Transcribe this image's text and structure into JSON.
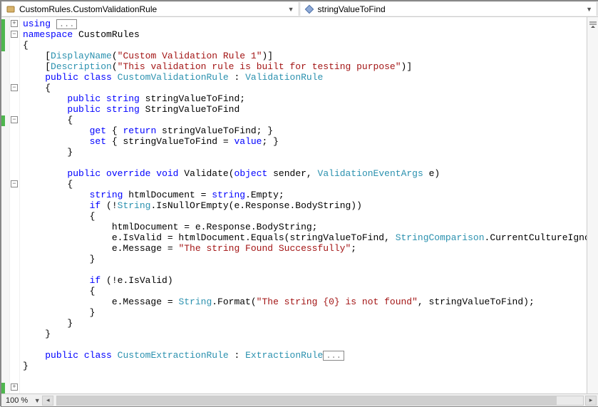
{
  "topbar": {
    "left_label": "CustomRules.CustomValidationRule",
    "right_label": "stringValueToFind"
  },
  "outline": {
    "plus_glyph": "+",
    "minus_glyph": "−",
    "collapsed_placeholder": "..."
  },
  "code": {
    "l01_kw": "using",
    "l02_kw": "namespace",
    "l02_name": "CustomRules",
    "l03": "{",
    "l04_a": "    [",
    "l04_type": "DisplayName",
    "l04_b": "(",
    "l04_str": "\"Custom Validation Rule 1\"",
    "l04_c": ")]",
    "l05_a": "    [",
    "l05_type": "Description",
    "l05_b": "(",
    "l05_str": "\"This validation rule is built for testing purpose\"",
    "l05_c": ")]",
    "l06_a": "    ",
    "l06_kw1": "public",
    "l06_kw2": "class",
    "l06_type1": "CustomValidationRule",
    "l06_colon": " : ",
    "l06_type2": "ValidationRule",
    "l07": "    {",
    "l08_a": "        ",
    "l08_kw1": "public",
    "l08_kw2": "string",
    "l08_name": " stringValueToFind;",
    "l09_a": "        ",
    "l09_kw1": "public",
    "l09_kw2": "string",
    "l09_name": " StringValueToFind",
    "l10": "        {",
    "l11_a": "            ",
    "l11_kw1": "get",
    "l11_b": " { ",
    "l11_kw2": "return",
    "l11_c": " stringValueToFind; }",
    "l12_a": "            ",
    "l12_kw1": "set",
    "l12_b": " { stringValueToFind = ",
    "l12_kw2": "value",
    "l12_c": "; }",
    "l13": "        }",
    "l15_a": "        ",
    "l15_kw1": "public",
    "l15_kw2": "override",
    "l15_kw3": "void",
    "l15_name": " Validate(",
    "l15_kw4": "object",
    "l15_arg": " sender, ",
    "l15_type": "ValidationEventArgs",
    "l15_end": " e)",
    "l16": "        {",
    "l17_a": "            ",
    "l17_kw1": "string",
    "l17_b": " htmlDocument = ",
    "l17_kw2": "string",
    "l17_c": ".Empty;",
    "l18_a": "            ",
    "l18_kw1": "if",
    "l18_b": " (!",
    "l18_type": "String",
    "l18_c": ".IsNullOrEmpty(e.Response.BodyString))",
    "l19": "            {",
    "l20": "                htmlDocument = e.Response.BodyString;",
    "l21_a": "                e.IsValid = htmlDocument.Equals(stringValueToFind, ",
    "l21_type": "StringComparison",
    "l21_b": ".CurrentCultureIgnoreCase);",
    "l22_a": "                e.Message = ",
    "l22_str": "\"The string Found Successfully\"",
    "l22_b": ";",
    "l23": "            }",
    "l25_a": "            ",
    "l25_kw": "if",
    "l25_b": " (!e.IsValid)",
    "l26": "            {",
    "l27_a": "                e.Message = ",
    "l27_type": "String",
    "l27_b": ".Format(",
    "l27_str": "\"The string {0} is not found\"",
    "l27_c": ", stringValueToFind);",
    "l28": "            }",
    "l29": "        }",
    "l30": "    }",
    "l32_a": "    ",
    "l32_kw1": "public",
    "l32_kw2": "class",
    "l32_type1": "CustomExtractionRule",
    "l32_colon": " : ",
    "l32_type2": "ExtractionRule",
    "l33": "}"
  },
  "status": {
    "zoom": "100 %"
  }
}
